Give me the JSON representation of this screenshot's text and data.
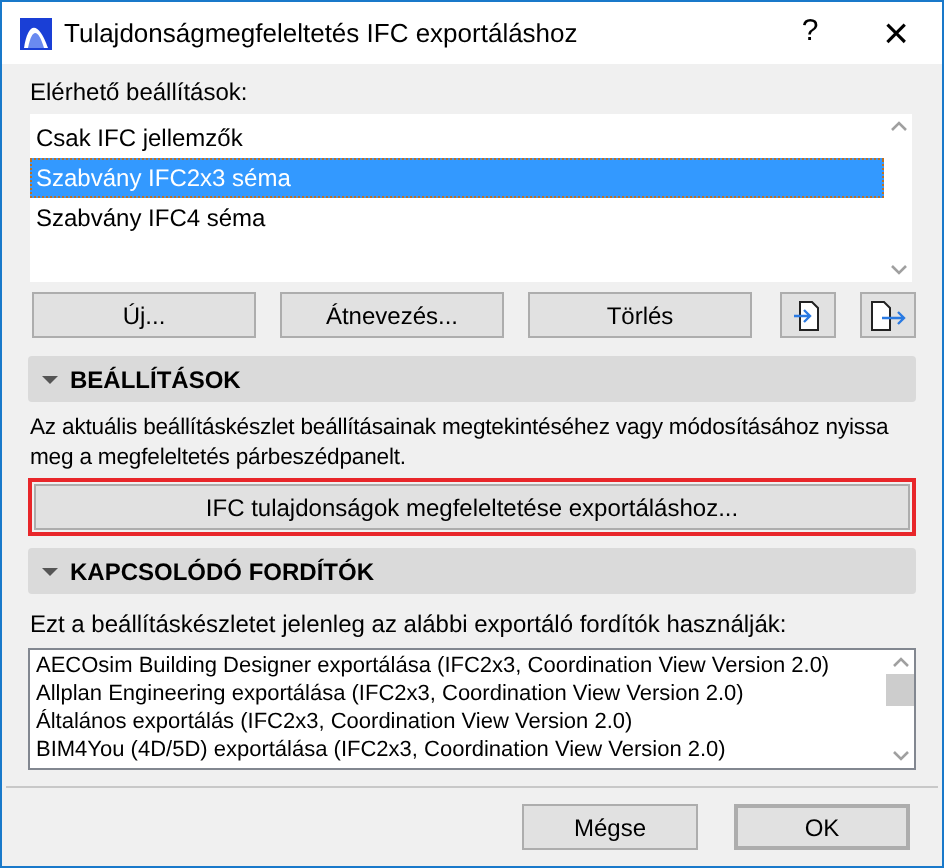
{
  "window": {
    "title": "Tulajdonságmegfeleltetés IFC exportáláshoz",
    "help": "?",
    "close": "×"
  },
  "presets": {
    "label": "Elérhető beállítások:",
    "items": [
      {
        "label": "Csak IFC jellemzők",
        "selected": false
      },
      {
        "label": "Szabvány IFC2x3 séma",
        "selected": true
      },
      {
        "label": "Szabvány IFC4 séma",
        "selected": false
      }
    ]
  },
  "preset_buttons": [
    "Új...",
    "Átnevezés...",
    "Törlés"
  ],
  "sections": [
    {
      "title": "BEÁLLÍTÁSOK",
      "expanded": true,
      "kind": "settings",
      "text": "Az aktuális beállításkészlet beállításainak megtekintéséhez vagy módosításához nyissa meg a megfeleltetés párbeszédpanelt.",
      "button": "IFC tulajdonságok megfeleltetése exportáláshoz...",
      "highlighted": true
    },
    {
      "title": "KAPCSOLÓDÓ FORDÍTÓK",
      "expanded": true,
      "kind": "list",
      "text": "Ezt a beállításkészletet jelenleg az alábbi exportáló fordítók használják:",
      "items": [
        "AECOsim Building Designer exportálása (IFC2x3, Coordination View Version 2.0)",
        "Allplan Engineering exportálása (IFC2x3, Coordination View Version 2.0)",
        "Általános exportálás (IFC2x3, Coordination View Version 2.0)",
        "BIM4You (4D/5D) exportálása (IFC2x3, Coordination View Version 2.0)"
      ]
    }
  ],
  "footer": {
    "cancel": "Mégse",
    "ok": "OK"
  }
}
